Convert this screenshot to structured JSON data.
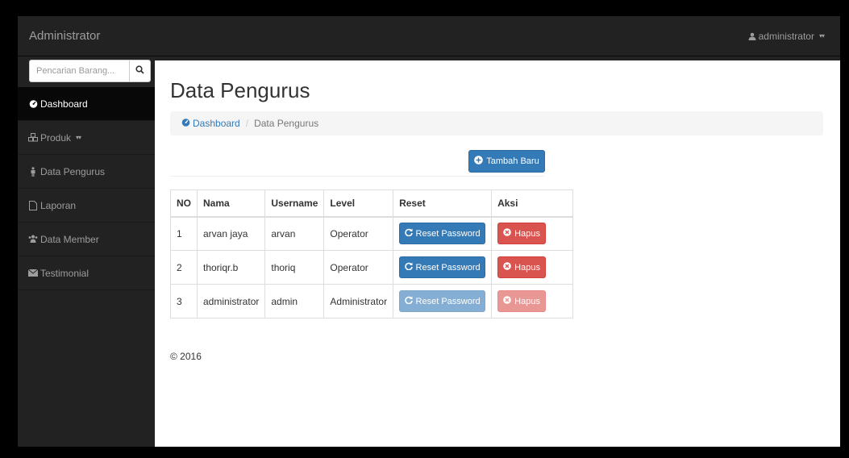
{
  "navbar": {
    "brand": "Administrator",
    "user": "administrator"
  },
  "sidebar": {
    "search": {
      "placeholder": "Pencarian Barang..."
    },
    "items": [
      {
        "label": "Dashboard",
        "icon": "dashboard-icon",
        "active": true
      },
      {
        "label": "Produk",
        "icon": "cubes-icon"
      },
      {
        "label": "Data Pengurus",
        "icon": "male-icon"
      },
      {
        "label": "Laporan",
        "icon": "file-icon"
      },
      {
        "label": "Data Member",
        "icon": "users-icon"
      },
      {
        "label": "Testimonial",
        "icon": "envelope-icon"
      }
    ]
  },
  "main": {
    "title": "Data Pengurus",
    "breadcrumb": {
      "home": "Dashboard",
      "current": "Data Pengurus"
    },
    "add_button": "Tambah Baru",
    "table": {
      "headers": [
        "NO",
        "Nama",
        "Username",
        "Level",
        "Reset",
        "Aksi"
      ],
      "rows": [
        {
          "no": "1",
          "nama": "arvan jaya",
          "username": "arvan",
          "level": "Operator",
          "reset": "Reset Password",
          "aksi": "Hapus",
          "disabled": false
        },
        {
          "no": "2",
          "nama": "thoriqr.b",
          "username": "thoriq",
          "level": "Operator",
          "reset": "Reset Password",
          "aksi": "Hapus",
          "disabled": false
        },
        {
          "no": "3",
          "nama": "administrator",
          "username": "admin",
          "level": "Administrator",
          "reset": "Reset Password",
          "aksi": "Hapus",
          "disabled": true
        }
      ]
    },
    "footer": "© 2016"
  },
  "colors": {
    "navbar_bg": "#222222",
    "primary": "#337ab7",
    "danger": "#d9534f"
  }
}
